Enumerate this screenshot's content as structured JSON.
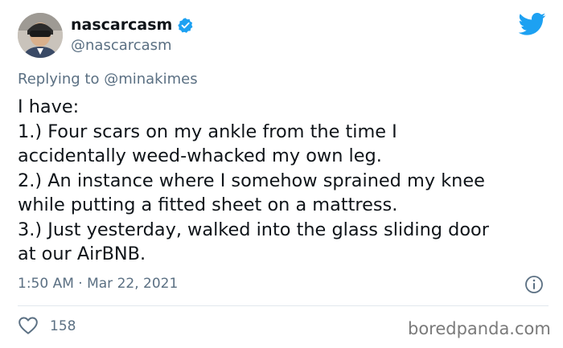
{
  "tweet": {
    "display_name": "nascarcasm",
    "handle": "@nascarcasm",
    "replying_prefix": "Replying to ",
    "replying_to": "@minakimes",
    "lines": [
      "I have:",
      "1.) Four scars on my ankle from the time I",
      "accidentally weed-whacked my own leg.",
      "2.) An instance where I somehow sprained my knee",
      "while putting a fitted sheet on a mattress.",
      "3.) Just yesterday, walked into the glass sliding door",
      "at our AirBNB."
    ],
    "timestamp": "1:50 AM · Mar 22, 2021",
    "like_count": "158"
  },
  "icons": {
    "verified": "verified-badge-icon",
    "brand": "twitter-bird-icon",
    "info": "info-icon",
    "like": "heart-icon"
  },
  "colors": {
    "twitter_blue": "#1da1f2",
    "secondary_text": "#5b7083",
    "primary_text": "#0f1419"
  },
  "watermark": "boredpanda.com"
}
